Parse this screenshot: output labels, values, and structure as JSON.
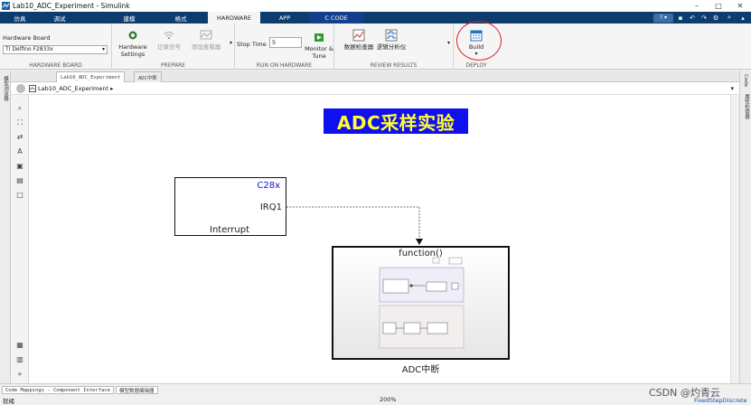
{
  "window": {
    "title": "Lab10_ADC_Experiment - Simulink",
    "controls": [
      "–",
      "□",
      "✕"
    ]
  },
  "tabs": [
    {
      "label": "仿真",
      "active": false
    },
    {
      "label": "调试",
      "active": false
    },
    {
      "label": "建模",
      "active": false
    },
    {
      "label": "格式",
      "active": false
    },
    {
      "label": "HARDWARE",
      "active": true
    },
    {
      "label": "APP",
      "active": false
    },
    {
      "label": "C CODE",
      "active": false
    }
  ],
  "ribbon": {
    "hardware_board": {
      "label": "Hardware Board",
      "value": "TI Delfino F2833x",
      "section": "HARDWARE BOARD"
    },
    "prepare": {
      "section": "PREPARE",
      "hardware_settings": "Hardware Settings",
      "log_signal": "记录信号",
      "add_viewer": "添加查看器"
    },
    "run": {
      "section": "RUN ON HARDWARE",
      "stop_time_label": "Stop Time",
      "stop_time_value": "5",
      "monitor_tune": "Monitor & Tune"
    },
    "review": {
      "section": "REVIEW RESULTS",
      "data_inspector": "数据检查器",
      "logic_analyzer": "逻辑分析仪"
    },
    "deploy": {
      "section": "DEPLOY",
      "build": "Build"
    }
  },
  "editor_tabs": [
    "Lab10_ADC_Experiment",
    "ADC中断"
  ],
  "left_strip_label": "模型浏览器",
  "right_strip_labels": [
    "Code",
    "属性检查器"
  ],
  "breadcrumb": "Lab10_ADC_Experiment",
  "canvas": {
    "annotation": "ADC采样实验",
    "c28x_block": {
      "title": "C28x",
      "port": "IRQ1",
      "name": "Interrupt"
    },
    "function_block": {
      "port": "function()",
      "name": "ADC中断"
    }
  },
  "status": {
    "tabs": [
      "Code Mappings - Component Interface",
      "模型数据编辑器"
    ],
    "left": "就绪",
    "zoom": "200%",
    "solver": "FixedStepDiscrete",
    "watermark": "CSDN @灼青云"
  },
  "colors": {
    "tabstrip": "#0d3d6e",
    "annotation_bg": "#1010ee",
    "annotation_fg": "#ffff33",
    "highlight": "#e02020"
  }
}
